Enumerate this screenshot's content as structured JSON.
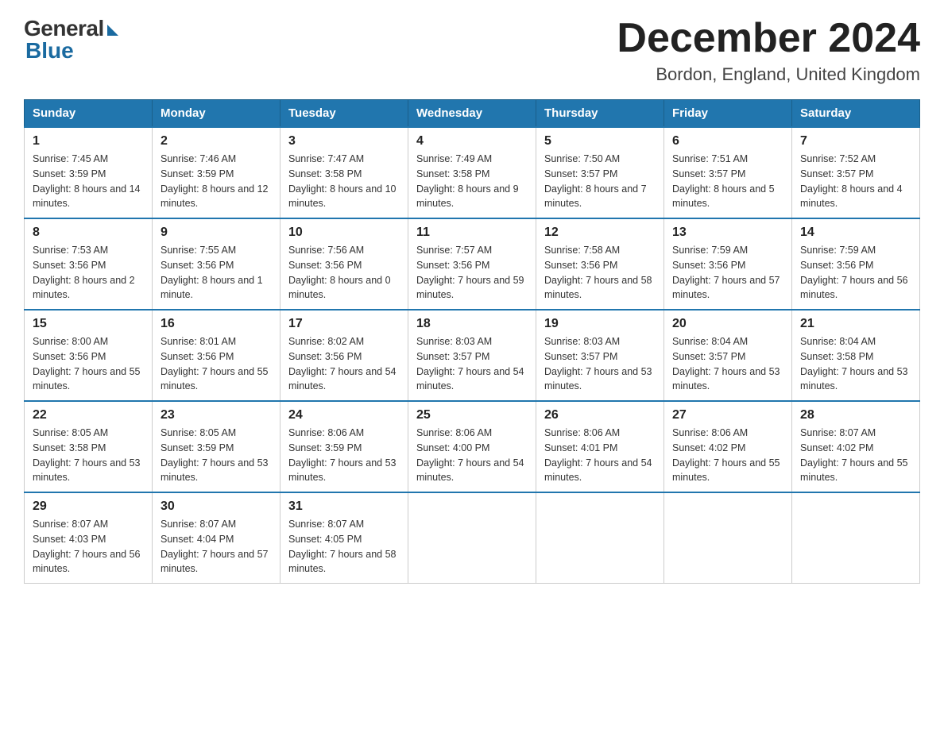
{
  "logo": {
    "general": "General",
    "blue": "Blue"
  },
  "title": "December 2024",
  "location": "Bordon, England, United Kingdom",
  "headers": [
    "Sunday",
    "Monday",
    "Tuesday",
    "Wednesday",
    "Thursday",
    "Friday",
    "Saturday"
  ],
  "weeks": [
    [
      {
        "day": "1",
        "sunrise": "7:45 AM",
        "sunset": "3:59 PM",
        "daylight": "8 hours and 14 minutes."
      },
      {
        "day": "2",
        "sunrise": "7:46 AM",
        "sunset": "3:59 PM",
        "daylight": "8 hours and 12 minutes."
      },
      {
        "day": "3",
        "sunrise": "7:47 AM",
        "sunset": "3:58 PM",
        "daylight": "8 hours and 10 minutes."
      },
      {
        "day": "4",
        "sunrise": "7:49 AM",
        "sunset": "3:58 PM",
        "daylight": "8 hours and 9 minutes."
      },
      {
        "day": "5",
        "sunrise": "7:50 AM",
        "sunset": "3:57 PM",
        "daylight": "8 hours and 7 minutes."
      },
      {
        "day": "6",
        "sunrise": "7:51 AM",
        "sunset": "3:57 PM",
        "daylight": "8 hours and 5 minutes."
      },
      {
        "day": "7",
        "sunrise": "7:52 AM",
        "sunset": "3:57 PM",
        "daylight": "8 hours and 4 minutes."
      }
    ],
    [
      {
        "day": "8",
        "sunrise": "7:53 AM",
        "sunset": "3:56 PM",
        "daylight": "8 hours and 2 minutes."
      },
      {
        "day": "9",
        "sunrise": "7:55 AM",
        "sunset": "3:56 PM",
        "daylight": "8 hours and 1 minute."
      },
      {
        "day": "10",
        "sunrise": "7:56 AM",
        "sunset": "3:56 PM",
        "daylight": "8 hours and 0 minutes."
      },
      {
        "day": "11",
        "sunrise": "7:57 AM",
        "sunset": "3:56 PM",
        "daylight": "7 hours and 59 minutes."
      },
      {
        "day": "12",
        "sunrise": "7:58 AM",
        "sunset": "3:56 PM",
        "daylight": "7 hours and 58 minutes."
      },
      {
        "day": "13",
        "sunrise": "7:59 AM",
        "sunset": "3:56 PM",
        "daylight": "7 hours and 57 minutes."
      },
      {
        "day": "14",
        "sunrise": "7:59 AM",
        "sunset": "3:56 PM",
        "daylight": "7 hours and 56 minutes."
      }
    ],
    [
      {
        "day": "15",
        "sunrise": "8:00 AM",
        "sunset": "3:56 PM",
        "daylight": "7 hours and 55 minutes."
      },
      {
        "day": "16",
        "sunrise": "8:01 AM",
        "sunset": "3:56 PM",
        "daylight": "7 hours and 55 minutes."
      },
      {
        "day": "17",
        "sunrise": "8:02 AM",
        "sunset": "3:56 PM",
        "daylight": "7 hours and 54 minutes."
      },
      {
        "day": "18",
        "sunrise": "8:03 AM",
        "sunset": "3:57 PM",
        "daylight": "7 hours and 54 minutes."
      },
      {
        "day": "19",
        "sunrise": "8:03 AM",
        "sunset": "3:57 PM",
        "daylight": "7 hours and 53 minutes."
      },
      {
        "day": "20",
        "sunrise": "8:04 AM",
        "sunset": "3:57 PM",
        "daylight": "7 hours and 53 minutes."
      },
      {
        "day": "21",
        "sunrise": "8:04 AM",
        "sunset": "3:58 PM",
        "daylight": "7 hours and 53 minutes."
      }
    ],
    [
      {
        "day": "22",
        "sunrise": "8:05 AM",
        "sunset": "3:58 PM",
        "daylight": "7 hours and 53 minutes."
      },
      {
        "day": "23",
        "sunrise": "8:05 AM",
        "sunset": "3:59 PM",
        "daylight": "7 hours and 53 minutes."
      },
      {
        "day": "24",
        "sunrise": "8:06 AM",
        "sunset": "3:59 PM",
        "daylight": "7 hours and 53 minutes."
      },
      {
        "day": "25",
        "sunrise": "8:06 AM",
        "sunset": "4:00 PM",
        "daylight": "7 hours and 54 minutes."
      },
      {
        "day": "26",
        "sunrise": "8:06 AM",
        "sunset": "4:01 PM",
        "daylight": "7 hours and 54 minutes."
      },
      {
        "day": "27",
        "sunrise": "8:06 AM",
        "sunset": "4:02 PM",
        "daylight": "7 hours and 55 minutes."
      },
      {
        "day": "28",
        "sunrise": "8:07 AM",
        "sunset": "4:02 PM",
        "daylight": "7 hours and 55 minutes."
      }
    ],
    [
      {
        "day": "29",
        "sunrise": "8:07 AM",
        "sunset": "4:03 PM",
        "daylight": "7 hours and 56 minutes."
      },
      {
        "day": "30",
        "sunrise": "8:07 AM",
        "sunset": "4:04 PM",
        "daylight": "7 hours and 57 minutes."
      },
      {
        "day": "31",
        "sunrise": "8:07 AM",
        "sunset": "4:05 PM",
        "daylight": "7 hours and 58 minutes."
      },
      null,
      null,
      null,
      null
    ]
  ]
}
